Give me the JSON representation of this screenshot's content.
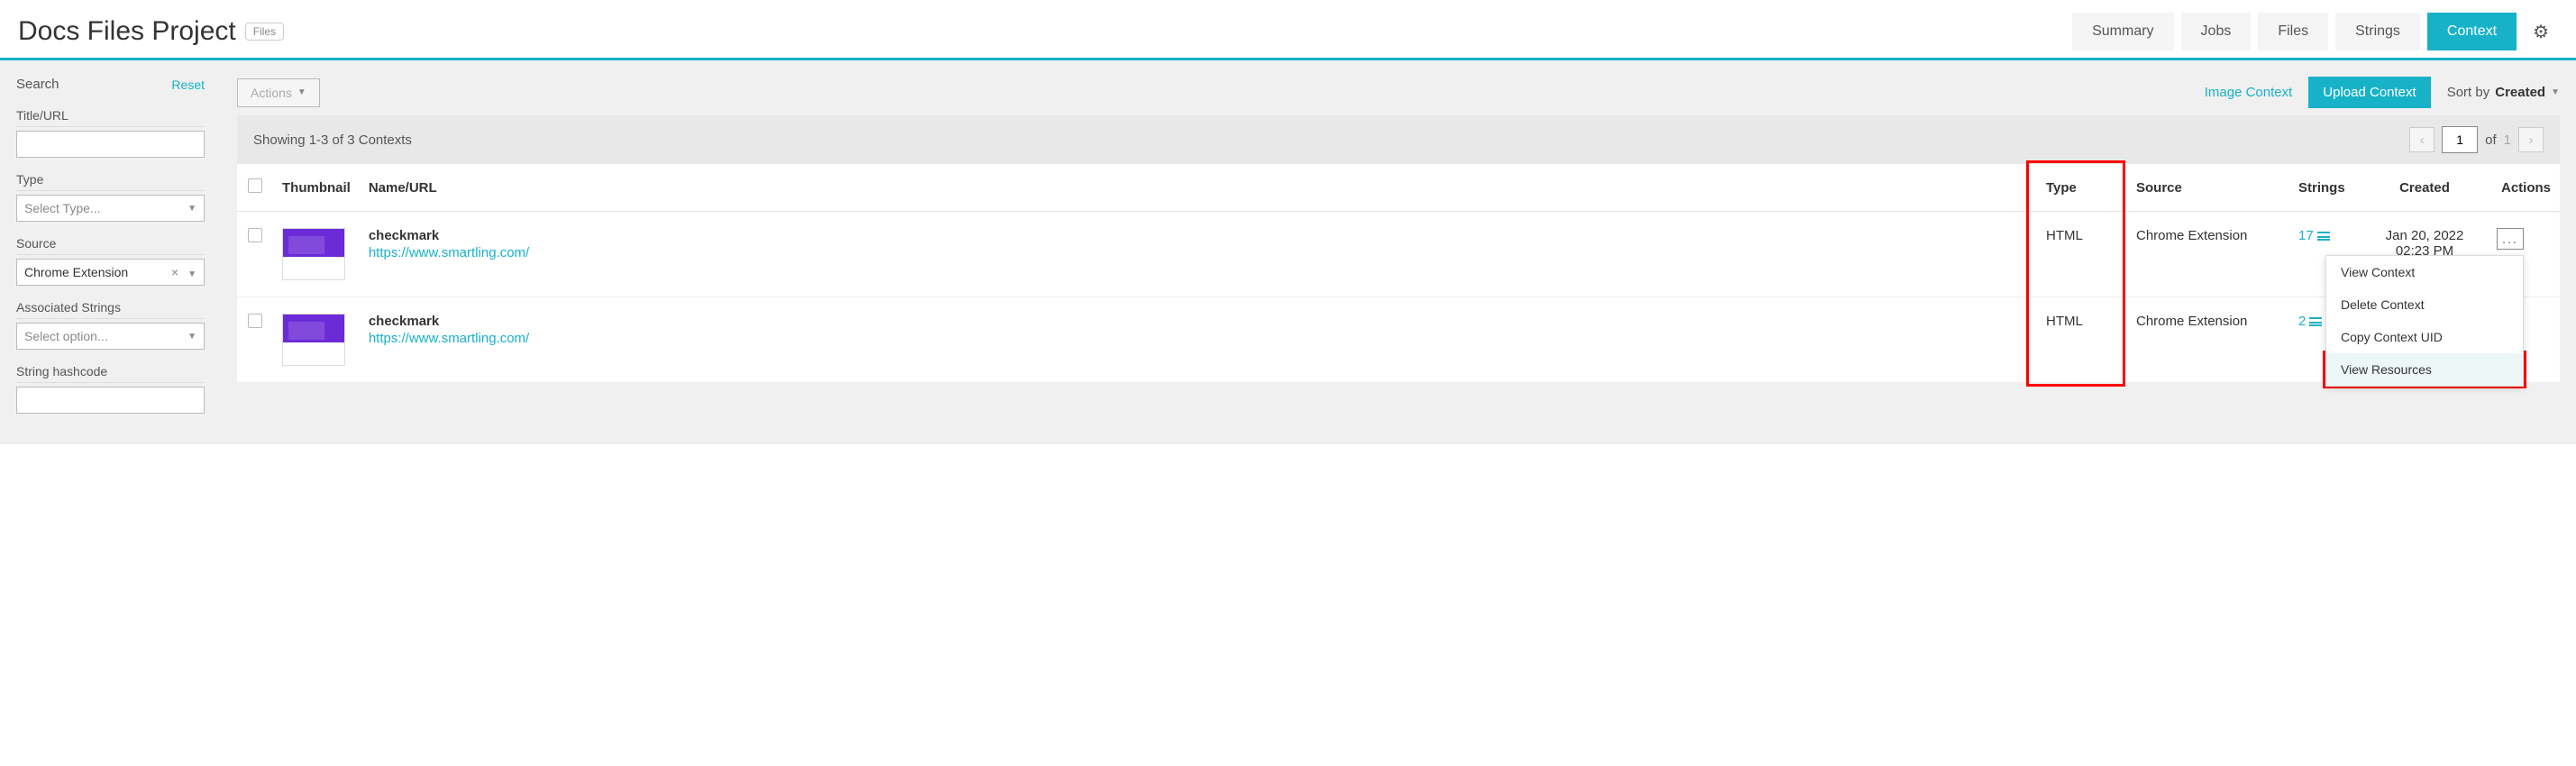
{
  "header": {
    "project_title": "Docs Files Project",
    "files_badge": "Files",
    "tabs": {
      "summary": "Summary",
      "jobs": "Jobs",
      "files": "Files",
      "strings": "Strings",
      "context": "Context"
    }
  },
  "sidebar": {
    "search_label": "Search",
    "reset": "Reset",
    "fields": {
      "title_url": "Title/URL",
      "type": "Type",
      "type_placeholder": "Select Type...",
      "source": "Source",
      "source_value": "Chrome Extension",
      "associated_strings": "Associated Strings",
      "associated_placeholder": "Select option...",
      "string_hashcode": "String hashcode"
    }
  },
  "toolbar": {
    "actions": "Actions",
    "image_context": "Image Context",
    "upload_context": "Upload Context",
    "sort_by": "Sort by",
    "sort_value": "Created"
  },
  "results": {
    "showing": "Showing 1-3 of 3 Contexts",
    "page_value": "1",
    "of": "of",
    "total": "1"
  },
  "table": {
    "headers": {
      "thumbnail": "Thumbnail",
      "name_url": "Name/URL",
      "type": "Type",
      "source": "Source",
      "strings": "Strings",
      "created": "Created",
      "actions": "Actions"
    },
    "rows": [
      {
        "name": "checkmark",
        "url": "https://www.smartling.com/",
        "type": "HTML",
        "source": "Chrome Extension",
        "strings": "17",
        "created_date": "Jan 20, 2022",
        "created_time": "02:23 PM"
      },
      {
        "name": "checkmark",
        "url": "https://www.smartling.com/",
        "type": "HTML",
        "source": "Chrome Extension",
        "strings": "2",
        "created_date": "",
        "created_time": ""
      }
    ]
  },
  "dropdown": {
    "view_context": "View Context",
    "delete_context": "Delete Context",
    "copy_uid": "Copy Context UID",
    "view_resources": "View Resources"
  }
}
